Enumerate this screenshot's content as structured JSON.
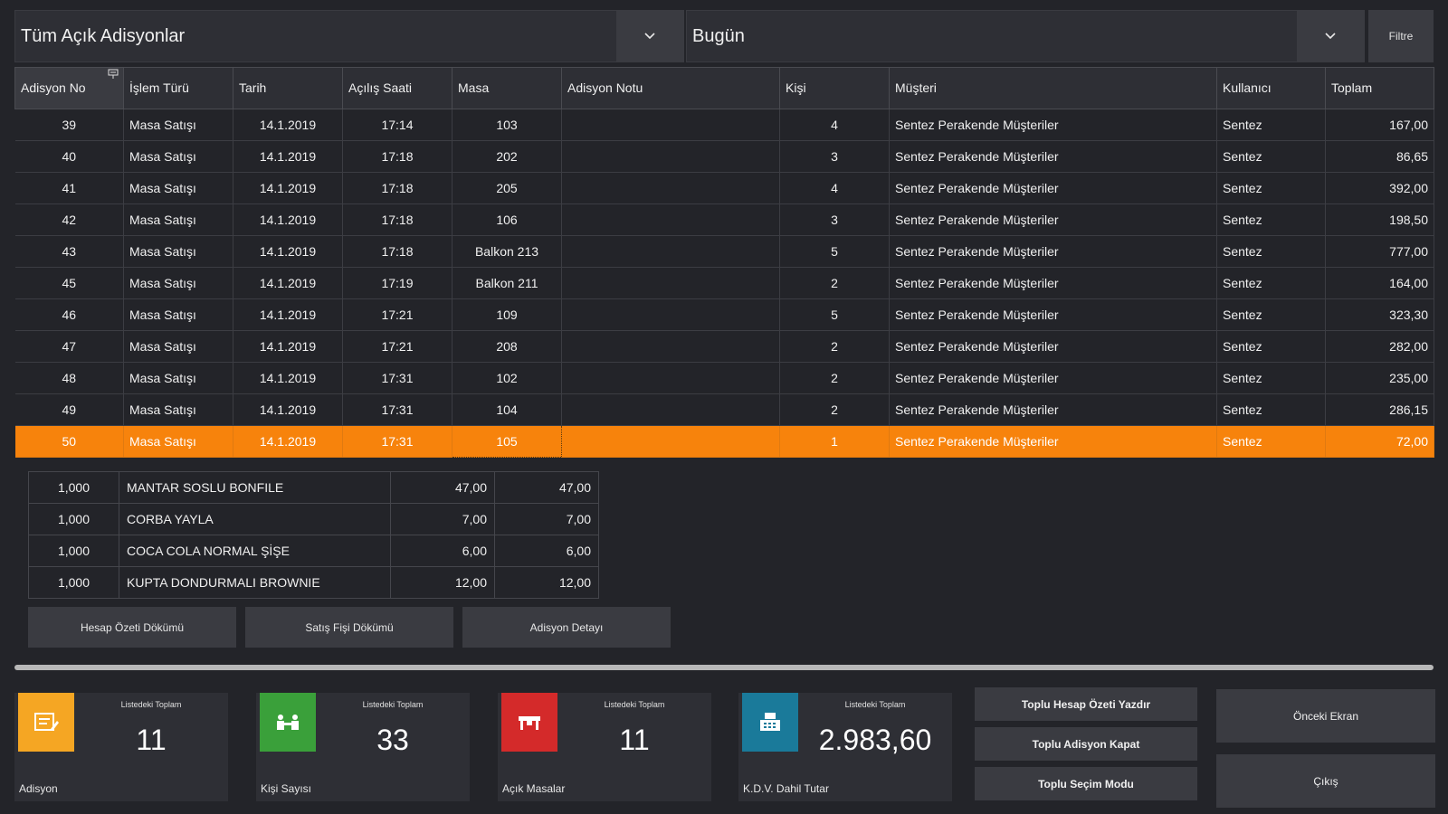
{
  "filters": {
    "scope_value": "Tüm Açık Adisyonlar",
    "date_value": "Bugün",
    "filter_label": "Filtre"
  },
  "grid": {
    "columns": [
      "Adisyon No",
      "İşlem Türü",
      "Tarih",
      "Açılış Saati",
      "Masa",
      "Adisyon Notu",
      "Kişi",
      "Müşteri",
      "Kullanıcı",
      "Toplam"
    ],
    "rows": [
      {
        "no": "39",
        "type": "Masa Satışı",
        "date": "14.1.2019",
        "time": "17:14",
        "table": "103",
        "note": "",
        "persons": "4",
        "customer": "Sentez Perakende Müşteriler",
        "user": "Sentez",
        "total": "167,00"
      },
      {
        "no": "40",
        "type": "Masa Satışı",
        "date": "14.1.2019",
        "time": "17:18",
        "table": "202",
        "note": "",
        "persons": "3",
        "customer": "Sentez Perakende Müşteriler",
        "user": "Sentez",
        "total": "86,65"
      },
      {
        "no": "41",
        "type": "Masa Satışı",
        "date": "14.1.2019",
        "time": "17:18",
        "table": "205",
        "note": "",
        "persons": "4",
        "customer": "Sentez Perakende Müşteriler",
        "user": "Sentez",
        "total": "392,00"
      },
      {
        "no": "42",
        "type": "Masa Satışı",
        "date": "14.1.2019",
        "time": "17:18",
        "table": "106",
        "note": "",
        "persons": "3",
        "customer": "Sentez Perakende Müşteriler",
        "user": "Sentez",
        "total": "198,50"
      },
      {
        "no": "43",
        "type": "Masa Satışı",
        "date": "14.1.2019",
        "time": "17:18",
        "table": "Balkon 213",
        "note": "",
        "persons": "5",
        "customer": "Sentez Perakende Müşteriler",
        "user": "Sentez",
        "total": "777,00"
      },
      {
        "no": "45",
        "type": "Masa Satışı",
        "date": "14.1.2019",
        "time": "17:19",
        "table": "Balkon 211",
        "note": "",
        "persons": "2",
        "customer": "Sentez Perakende Müşteriler",
        "user": "Sentez",
        "total": "164,00"
      },
      {
        "no": "46",
        "type": "Masa Satışı",
        "date": "14.1.2019",
        "time": "17:21",
        "table": "109",
        "note": "",
        "persons": "5",
        "customer": "Sentez Perakende Müşteriler",
        "user": "Sentez",
        "total": "323,30"
      },
      {
        "no": "47",
        "type": "Masa Satışı",
        "date": "14.1.2019",
        "time": "17:21",
        "table": "208",
        "note": "",
        "persons": "2",
        "customer": "Sentez Perakende Müşteriler",
        "user": "Sentez",
        "total": "282,00"
      },
      {
        "no": "48",
        "type": "Masa Satışı",
        "date": "14.1.2019",
        "time": "17:31",
        "table": "102",
        "note": "",
        "persons": "2",
        "customer": "Sentez Perakende Müşteriler",
        "user": "Sentez",
        "total": "235,00"
      },
      {
        "no": "49",
        "type": "Masa Satışı",
        "date": "14.1.2019",
        "time": "17:31",
        "table": "104",
        "note": "",
        "persons": "2",
        "customer": "Sentez Perakende Müşteriler",
        "user": "Sentez",
        "total": "286,15"
      },
      {
        "no": "50",
        "type": "Masa Satışı",
        "date": "14.1.2019",
        "time": "17:31",
        "table": "105",
        "note": "",
        "persons": "1",
        "customer": "Sentez Perakende Müşteriler",
        "user": "Sentez",
        "total": "72,00",
        "selected": true
      }
    ]
  },
  "detail": {
    "items": [
      {
        "qty": "1,000",
        "name": "MANTAR SOSLU BONFILE",
        "price": "47,00",
        "amount": "47,00"
      },
      {
        "qty": "1,000",
        "name": "CORBA YAYLA",
        "price": "7,00",
        "amount": "7,00"
      },
      {
        "qty": "1,000",
        "name": "COCA COLA NORMAL ŞİŞE",
        "price": "6,00",
        "amount": "6,00"
      },
      {
        "qty": "1,000",
        "name": "KUPTA DONDURMALI BROWNIE",
        "price": "12,00",
        "amount": "12,00"
      }
    ],
    "buttons": [
      "Hesap Özeti Dökümü",
      "Satış Fişi Dökümü",
      "Adisyon Detayı"
    ]
  },
  "stats": [
    {
      "caption": "Listedeki Toplam",
      "value": "11",
      "label": "Adisyon",
      "icon": "receipt-icon",
      "color": "#f5a623"
    },
    {
      "caption": "Listedeki Toplam",
      "value": "33",
      "label": "Kişi Sayısı",
      "icon": "people-icon",
      "color": "#3aa03a"
    },
    {
      "caption": "Listedeki Toplam",
      "value": "11",
      "label": "Açık Masalar",
      "icon": "table-icon",
      "color": "#d42a2a"
    },
    {
      "caption": "Listedeki Toplam",
      "value": "2.983,60",
      "label": "K.D.V. Dahil Tutar",
      "icon": "cash-register-icon",
      "color": "#1a7a9a"
    }
  ],
  "bulk": {
    "print_summary": "Toplu Hesap Özeti Yazdır",
    "close_checks": "Toplu Adisyon Kapat",
    "select_mode": "Toplu Seçim Modu"
  },
  "nav": {
    "previous": "Önceki Ekran",
    "exit": "Çıkış"
  }
}
